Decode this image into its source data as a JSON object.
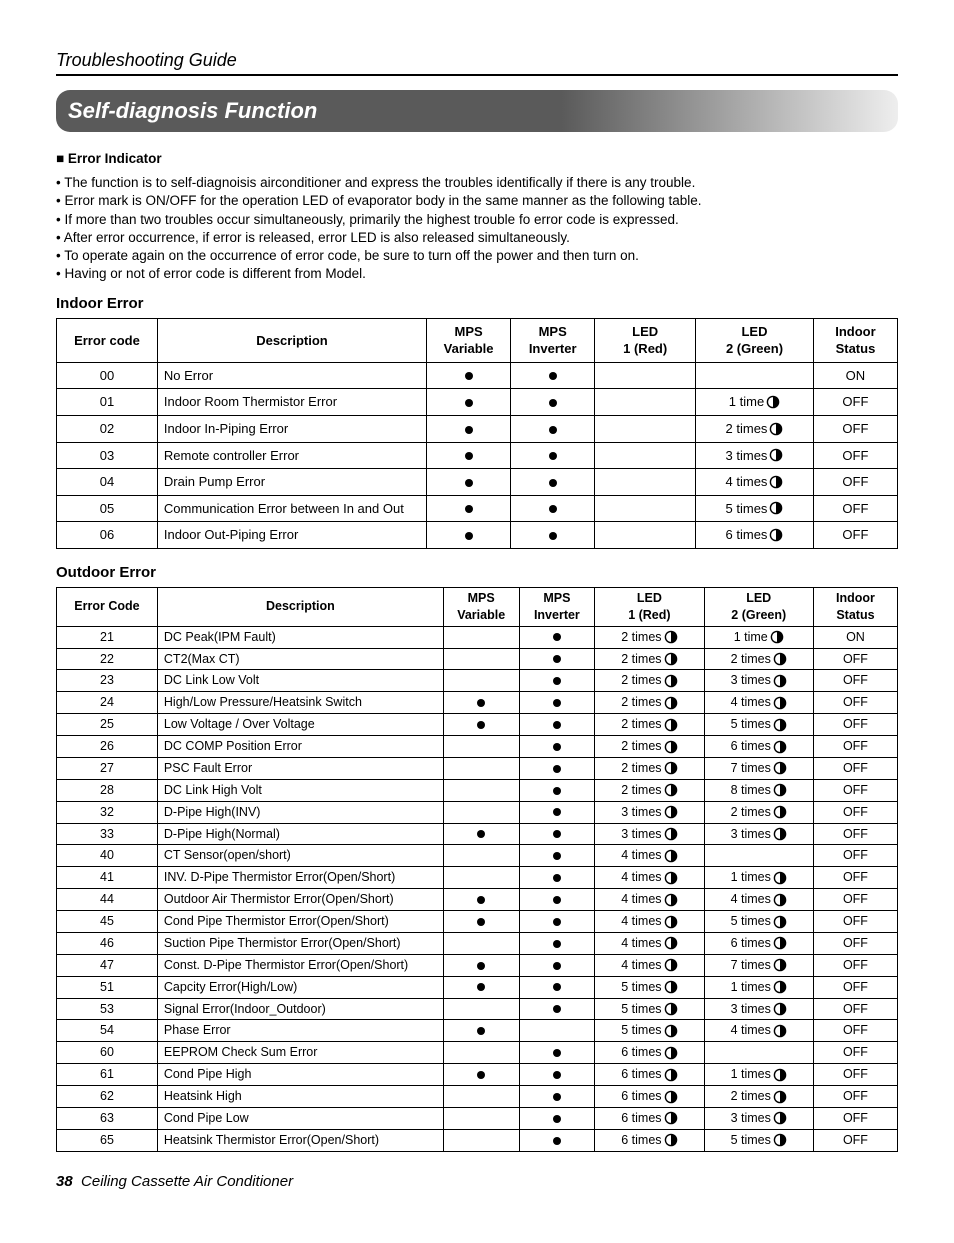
{
  "header": "Troubleshooting Guide",
  "banner": "Self-diagnosis Function",
  "section_sub": "Error Indicator",
  "bullets": [
    "The function is to self-diagnoisis airconditioner and express the troubles identifically if there is any trouble.",
    "Error mark is ON/OFF for the operation LED of evaporator body in the same manner as the following table.",
    "If more than two troubles occur simultaneously, primarily the highest trouble fo error code is expressed.",
    "After error occurrence, if error is released, error LED is also released simultaneously.",
    "To operate again on the occurrence of error code, be sure to turn off the power and then turn on.",
    "Having or not of error code is different from Model."
  ],
  "indoor": {
    "title": "Indoor Error",
    "headers": [
      "Error code",
      "Description",
      "MPS Variable",
      "MPS Inverter",
      "LED 1 (Red)",
      "LED 2 (Green)",
      "Indoor Status"
    ],
    "rows": [
      {
        "code": "00",
        "desc": "No Error",
        "var": "dot",
        "inv": "dot",
        "led1": "",
        "led2": "",
        "status": "ON"
      },
      {
        "code": "01",
        "desc": "Indoor Room Thermistor Error",
        "var": "dot",
        "inv": "dot",
        "led1": "",
        "led2": "1 time",
        "status": "OFF"
      },
      {
        "code": "02",
        "desc": "Indoor In-Piping Error",
        "var": "dot",
        "inv": "dot",
        "led1": "",
        "led2": "2 times",
        "status": "OFF"
      },
      {
        "code": "03",
        "desc": "Remote controller Error",
        "var": "dot",
        "inv": "dot",
        "led1": "",
        "led2": "3 times",
        "status": "OFF"
      },
      {
        "code": "04",
        "desc": "Drain Pump Error",
        "var": "dot",
        "inv": "dot",
        "led1": "",
        "led2": "4 times",
        "status": "OFF"
      },
      {
        "code": "05",
        "desc": "Communication Error between In and Out",
        "var": "dot",
        "inv": "dot",
        "led1": "",
        "led2": "5 times",
        "status": "OFF"
      },
      {
        "code": "06",
        "desc": "Indoor Out-Piping Error",
        "var": "dot",
        "inv": "dot",
        "led1": "",
        "led2": "6 times",
        "status": "OFF"
      }
    ]
  },
  "outdoor": {
    "title": "Outdoor Error",
    "headers": [
      "Error Code",
      "Description",
      "MPS Variable",
      "MPS Inverter",
      "LED 1 (Red)",
      "LED 2 (Green)",
      "Indoor Status"
    ],
    "rows": [
      {
        "code": "21",
        "desc": "DC Peak(IPM Fault)",
        "var": "",
        "inv": "dot",
        "led1": "2 times",
        "led2": "1 time",
        "status": "ON"
      },
      {
        "code": "22",
        "desc": "CT2(Max CT)",
        "var": "",
        "inv": "dot",
        "led1": "2 times",
        "led2": "2 times",
        "status": "OFF"
      },
      {
        "code": "23",
        "desc": "DC Link Low Volt",
        "var": "",
        "inv": "dot",
        "led1": "2 times",
        "led2": "3 times",
        "status": "OFF"
      },
      {
        "code": "24",
        "desc": "High/Low Pressure/Heatsink Switch",
        "var": "dot",
        "inv": "dot",
        "led1": "2 times",
        "led2": "4 times",
        "status": "OFF"
      },
      {
        "code": "25",
        "desc": "Low Voltage / Over Voltage",
        "var": "dot",
        "inv": "dot",
        "led1": "2 times",
        "led2": "5 times",
        "status": "OFF"
      },
      {
        "code": "26",
        "desc": "DC COMP Position Error",
        "var": "",
        "inv": "dot",
        "led1": "2 times",
        "led2": "6 times",
        "status": "OFF"
      },
      {
        "code": "27",
        "desc": "PSC Fault Error",
        "var": "",
        "inv": "dot",
        "led1": "2 times",
        "led2": "7 times",
        "status": "OFF"
      },
      {
        "code": "28",
        "desc": "DC Link High Volt",
        "var": "",
        "inv": "dot",
        "led1": "2 times",
        "led2": "8 times",
        "status": "OFF"
      },
      {
        "code": "32",
        "desc": "D-Pipe High(INV)",
        "var": "",
        "inv": "dot",
        "led1": "3 times",
        "led2": "2 times",
        "status": "OFF"
      },
      {
        "code": "33",
        "desc": "D-Pipe High(Normal)",
        "var": "dot",
        "inv": "dot",
        "led1": "3 times",
        "led2": "3 times",
        "status": "OFF"
      },
      {
        "code": "40",
        "desc": "CT Sensor(open/short)",
        "var": "",
        "inv": "dot",
        "led1": "4 times",
        "led2": "",
        "status": "OFF"
      },
      {
        "code": "41",
        "desc": "INV. D-Pipe Thermistor Error(Open/Short)",
        "var": "",
        "inv": "dot",
        "led1": "4 times",
        "led2": "1 times",
        "status": "OFF"
      },
      {
        "code": "44",
        "desc": "Outdoor Air Thermistor Error(Open/Short)",
        "var": "dot",
        "inv": "dot",
        "led1": "4 times",
        "led2": "4 times",
        "status": "OFF"
      },
      {
        "code": "45",
        "desc": "Cond Pipe Thermistor Error(Open/Short)",
        "var": "dot",
        "inv": "dot",
        "led1": "4 times",
        "led2": "5 times",
        "status": "OFF"
      },
      {
        "code": "46",
        "desc": "Suction Pipe Thermistor Error(Open/Short)",
        "var": "",
        "inv": "dot",
        "led1": "4 times",
        "led2": "6 times",
        "status": "OFF"
      },
      {
        "code": "47",
        "desc": "Const. D-Pipe Thermistor Error(Open/Short)",
        "var": "dot",
        "inv": "dot",
        "led1": "4 times",
        "led2": "7 times",
        "status": "OFF"
      },
      {
        "code": "51",
        "desc": "Capcity Error(High/Low)",
        "var": "dot",
        "inv": "dot",
        "led1": "5 times",
        "led2": "1 times",
        "status": "OFF"
      },
      {
        "code": "53",
        "desc": "Signal Error(Indoor_Outdoor)",
        "var": "",
        "inv": "dot",
        "led1": "5 times",
        "led2": "3 times",
        "status": "OFF"
      },
      {
        "code": "54",
        "desc": "Phase Error",
        "var": "dot",
        "inv": "",
        "led1": "5 times",
        "led2": "4 times",
        "status": "OFF"
      },
      {
        "code": "60",
        "desc": "EEPROM Check Sum Error",
        "var": "",
        "inv": "dot",
        "led1": "6 times",
        "led2": "",
        "status": "OFF"
      },
      {
        "code": "61",
        "desc": "Cond Pipe High",
        "var": "dot",
        "inv": "dot",
        "led1": "6 times",
        "led2": "1 times",
        "status": "OFF"
      },
      {
        "code": "62",
        "desc": "Heatsink High",
        "var": "",
        "inv": "dot",
        "led1": "6 times",
        "led2": "2 times",
        "status": "OFF"
      },
      {
        "code": "63",
        "desc": "Cond Pipe Low",
        "var": "",
        "inv": "dot",
        "led1": "6 times",
        "led2": "3 times",
        "status": "OFF"
      },
      {
        "code": "65",
        "desc": "Heatsink Thermistor Error(Open/Short)",
        "var": "",
        "inv": "dot",
        "led1": "6 times",
        "led2": "5 times",
        "status": "OFF"
      }
    ]
  },
  "footer": {
    "page": "38",
    "title": "Ceiling Cassette Air Conditioner"
  }
}
